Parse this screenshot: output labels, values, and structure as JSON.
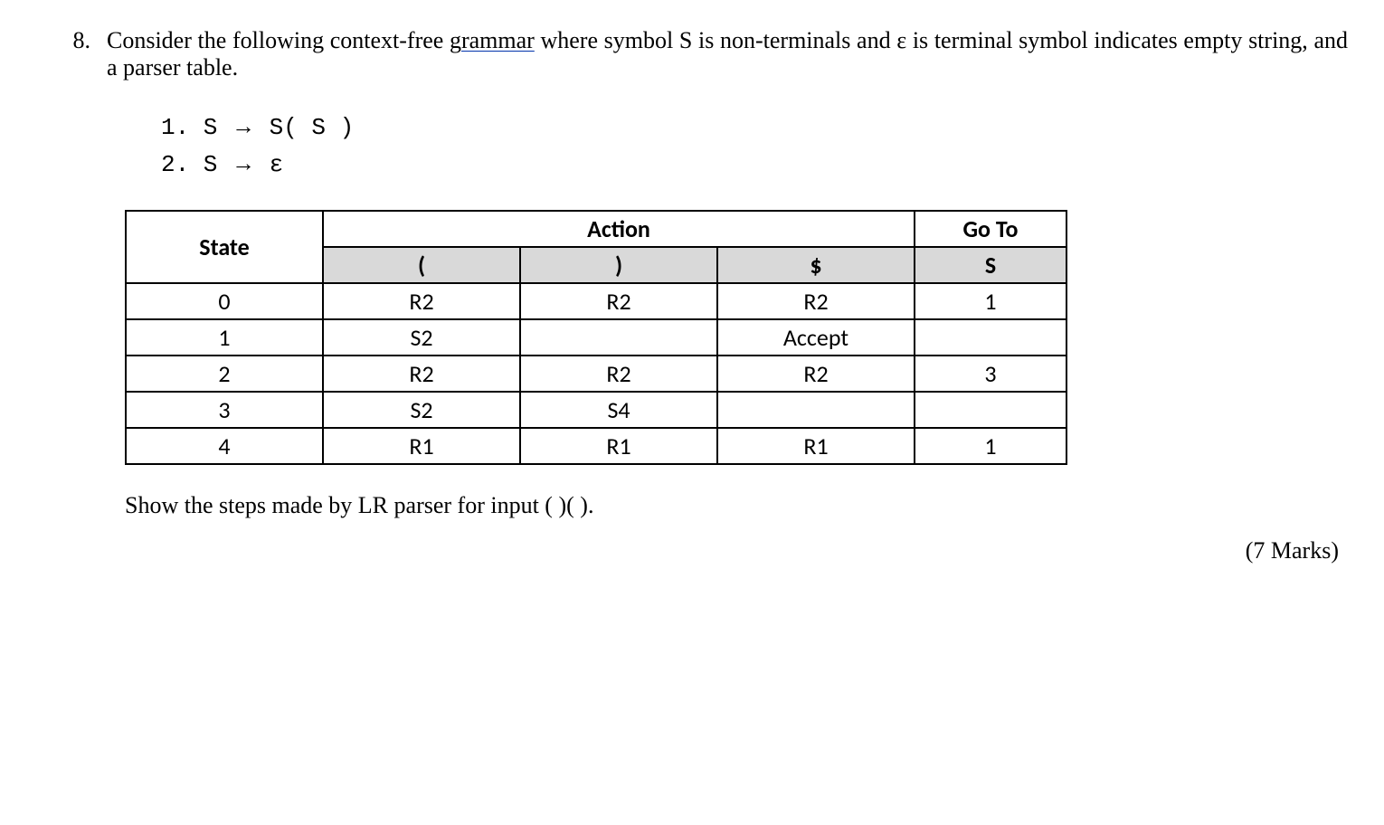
{
  "question": {
    "number": "8.",
    "text_part1": "Consider the following context-free ",
    "underlined_word": "grammar",
    "text_part2": " where symbol S is non-terminals and ε is terminal symbol indicates empty string, and a parser table."
  },
  "grammar": {
    "line1_prefix": "1. S ",
    "arrow": "→",
    "line1_rhs": " S( S )",
    "line2_prefix": "2. S ",
    "line2_rhs": " ε"
  },
  "table": {
    "headers": {
      "state": "State",
      "action": "Action",
      "goto": "Go To"
    },
    "subheaders": {
      "lparen": "(",
      "rparen": ")",
      "dollar": "$",
      "S": "S"
    },
    "rows": [
      {
        "state": "0",
        "lparen": "R2",
        "rparen": "R2",
        "dollar": "R2",
        "S": "1"
      },
      {
        "state": "1",
        "lparen": "S2",
        "rparen": "",
        "dollar": "Accept",
        "S": ""
      },
      {
        "state": "2",
        "lparen": "R2",
        "rparen": "R2",
        "dollar": "R2",
        "S": "3"
      },
      {
        "state": "3",
        "lparen": "S2",
        "rparen": "S4",
        "dollar": "",
        "S": ""
      },
      {
        "state": "4",
        "lparen": "R1",
        "rparen": "R1",
        "dollar": "R1",
        "S": "1"
      }
    ]
  },
  "instruction": "Show the steps made by LR parser for input ( )( ).",
  "marks": "(7 Marks)"
}
